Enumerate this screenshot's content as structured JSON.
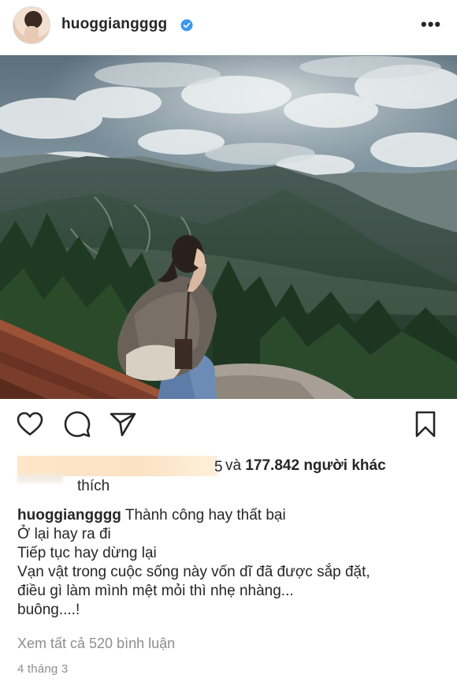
{
  "header": {
    "username": "huoggiangggg",
    "more_label": "•••",
    "verified_icon": "verified-badge-icon",
    "avatar_icon": "profile-avatar"
  },
  "post": {
    "photo_icon": "mountain-landscape-photo"
  },
  "actions": {
    "like_icon": "heart-icon",
    "comment_icon": "comment-icon",
    "share_icon": "send-icon",
    "save_icon": "bookmark-icon"
  },
  "likes": {
    "liker_tail": "5",
    "conjunction": "và",
    "count_text": "177.842 người khác",
    "second_line": "thích"
  },
  "caption": {
    "username": "huoggiangggg",
    "lines": [
      "Thành công hay thất bại",
      "Ở lại hay ra đi",
      "Tiếp tục hay dừng lại",
      "Vạn vật trong cuộc sống này vốn dĩ đã được sắp đặt,",
      "điều gì làm mình mệt mỏi thì nhẹ nhàng...",
      "buông....!"
    ]
  },
  "comments_link": "Xem tất cả 520 bình luận",
  "date": "4 tháng 3",
  "colors": {
    "text": "#262626",
    "muted": "#8e8e8e",
    "verified_blue": "#3897f0"
  }
}
